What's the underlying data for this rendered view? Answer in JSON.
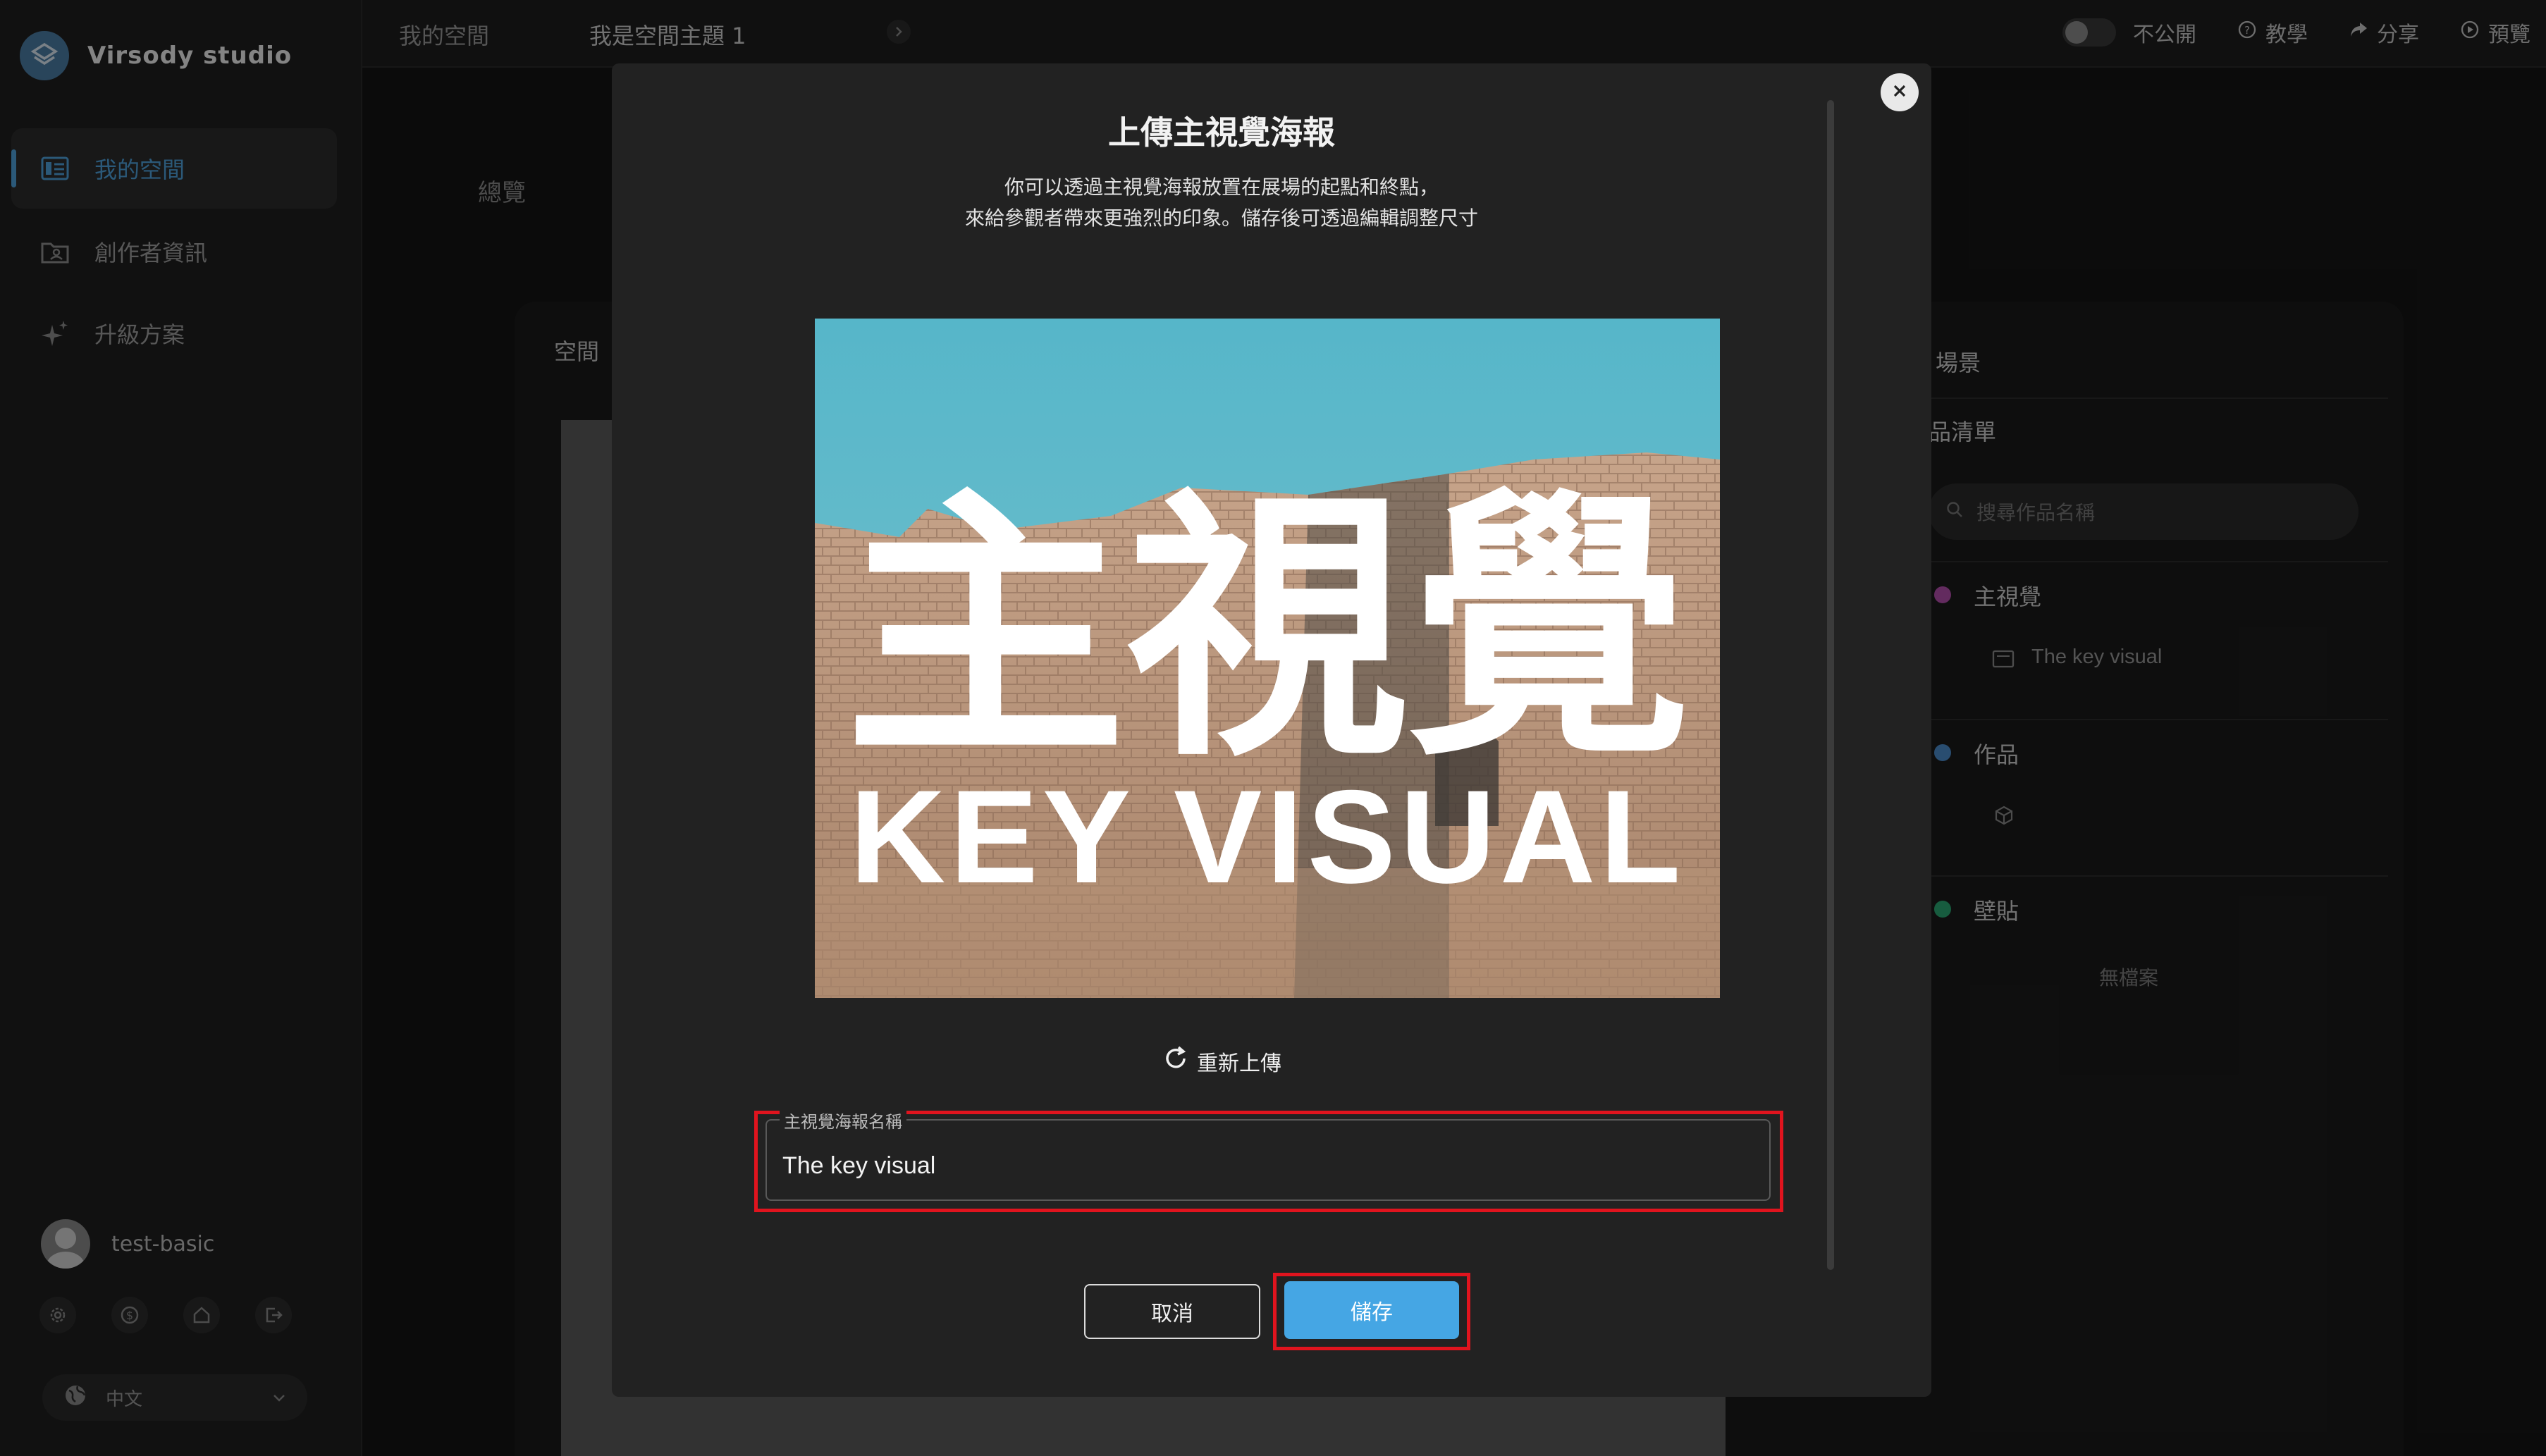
{
  "app": {
    "name": "Virsody studio"
  },
  "sidebar": {
    "items": [
      {
        "label": "我的空間",
        "icon": "layout-icon",
        "active": true
      },
      {
        "label": "創作者資訊",
        "icon": "folder-user-icon",
        "active": false
      },
      {
        "label": "升級方案",
        "icon": "sparkle-icon",
        "active": false
      }
    ],
    "user": {
      "name": "test-basic"
    },
    "utilities": [
      "gear-icon",
      "dollar-icon",
      "home-icon",
      "logout-icon"
    ],
    "language": "中文"
  },
  "breadcrumb": {
    "items": [
      "我的空間",
      "我是空間主題 1"
    ]
  },
  "top_actions": {
    "visibility": "不公開",
    "tutorial": "教學",
    "share": "分享",
    "preview": "預覽"
  },
  "background": {
    "tab": "總覽",
    "card_title": "空間",
    "panel": {
      "scene": "場景",
      "work_list": "品清單",
      "search_placeholder": "搜尋作品名稱",
      "groups": [
        {
          "label": "主視覺",
          "color": "#b44fae",
          "item": "The key visual"
        },
        {
          "label": "作品",
          "color": "#4b8ccd",
          "item": ""
        },
        {
          "label": "壁貼",
          "color": "#2aa873",
          "item": "無檔案"
        }
      ]
    }
  },
  "modal": {
    "title": "上傳主視覺海報",
    "description_line1": "你可以透過主視覺海報放置在展場的起點和終點，",
    "description_line2": "來給參觀者帶來更強烈的印象。儲存後可透過編輯調整尺寸",
    "poster": {
      "headline": "主視覺",
      "subhead": "KEY VISUAL"
    },
    "reupload_label": "重新上傳",
    "field": {
      "label": "主視覺海報名稱",
      "value": "The key visual"
    },
    "cancel_label": "取消",
    "save_label": "儲存"
  },
  "colors": {
    "accent": "#45a6e4",
    "highlight": "#e0141e"
  }
}
